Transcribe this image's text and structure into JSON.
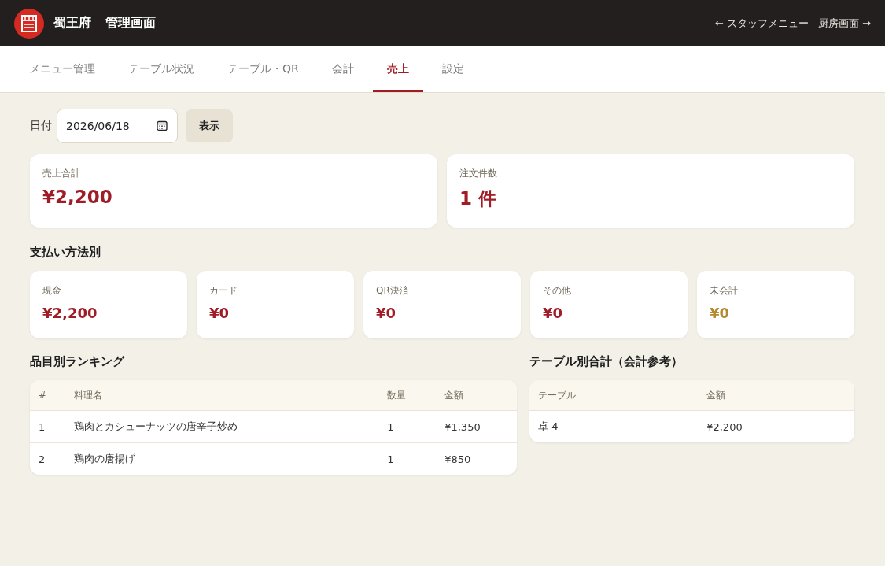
{
  "header": {
    "brand": "蜀王府",
    "title": "管理画面",
    "links": [
      {
        "label": "← スタッフメニュー"
      },
      {
        "label": "厨房画面 →"
      }
    ]
  },
  "tabs": [
    {
      "label": "メニュー管理",
      "selected": false
    },
    {
      "label": "テーブル状況",
      "selected": false
    },
    {
      "label": "テーブル・QR",
      "selected": false
    },
    {
      "label": "会計",
      "selected": false
    },
    {
      "label": "売上",
      "selected": true
    },
    {
      "label": "設定",
      "selected": false
    }
  ],
  "date_filter": {
    "label": "日付",
    "value": "2026/06/18",
    "button": "表示"
  },
  "summary": [
    {
      "label": "売上合計",
      "value": "¥2,200"
    },
    {
      "label": "注文件数",
      "value": "1 件"
    }
  ],
  "payments": {
    "title": "支払い方法別",
    "items": [
      {
        "label": "現金",
        "value": "¥2,200",
        "color": "#a01c26"
      },
      {
        "label": "カード",
        "value": "¥0",
        "color": "#a01c26"
      },
      {
        "label": "QR決済",
        "value": "¥0",
        "color": "#a01c26"
      },
      {
        "label": "その他",
        "value": "¥0",
        "color": "#a01c26"
      },
      {
        "label": "未会計",
        "value": "¥0",
        "color": "#b38a2d"
      }
    ]
  },
  "ranking": {
    "title": "品目別ランキング",
    "columns": [
      "#",
      "料理名",
      "数量",
      "金額"
    ],
    "rows": [
      [
        "1",
        "鶏肉とカシューナッツの唐辛子炒め",
        "1",
        "¥1,350"
      ],
      [
        "2",
        "鶏肉の唐揚げ",
        "1",
        "¥850"
      ]
    ]
  },
  "table_totals": {
    "title": "テーブル別合計（会計参考）",
    "columns": [
      "テーブル",
      "金額"
    ],
    "rows": [
      [
        "卓 4",
        "¥2,200"
      ]
    ]
  }
}
